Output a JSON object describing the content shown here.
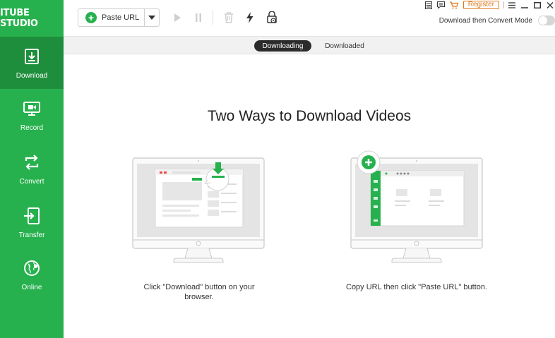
{
  "app": {
    "logo": "ITUBE STUDIO"
  },
  "sidebar": {
    "items": [
      {
        "label": "Download",
        "icon": "download-icon"
      },
      {
        "label": "Record",
        "icon": "record-icon"
      },
      {
        "label": "Convert",
        "icon": "convert-icon"
      },
      {
        "label": "Transfer",
        "icon": "transfer-icon"
      },
      {
        "label": "Online",
        "icon": "globe-icon"
      }
    ]
  },
  "toolbar": {
    "paste_url_label": "Paste URL",
    "register_label": "Register",
    "convert_mode_label": "Download then Convert Mode"
  },
  "tabs": {
    "downloading": "Downloading",
    "downloaded": "Downloaded"
  },
  "main": {
    "title": "Two Ways to Download Videos",
    "way1_caption_line1": "Click \"Download\" button on your",
    "way1_caption_line2": "browser.",
    "way2_caption": "Copy URL then click \"Paste URL\" button."
  },
  "colors": {
    "accent": "#27b14e",
    "accent_dark": "#1f8e3c",
    "register": "#e07a1b"
  }
}
